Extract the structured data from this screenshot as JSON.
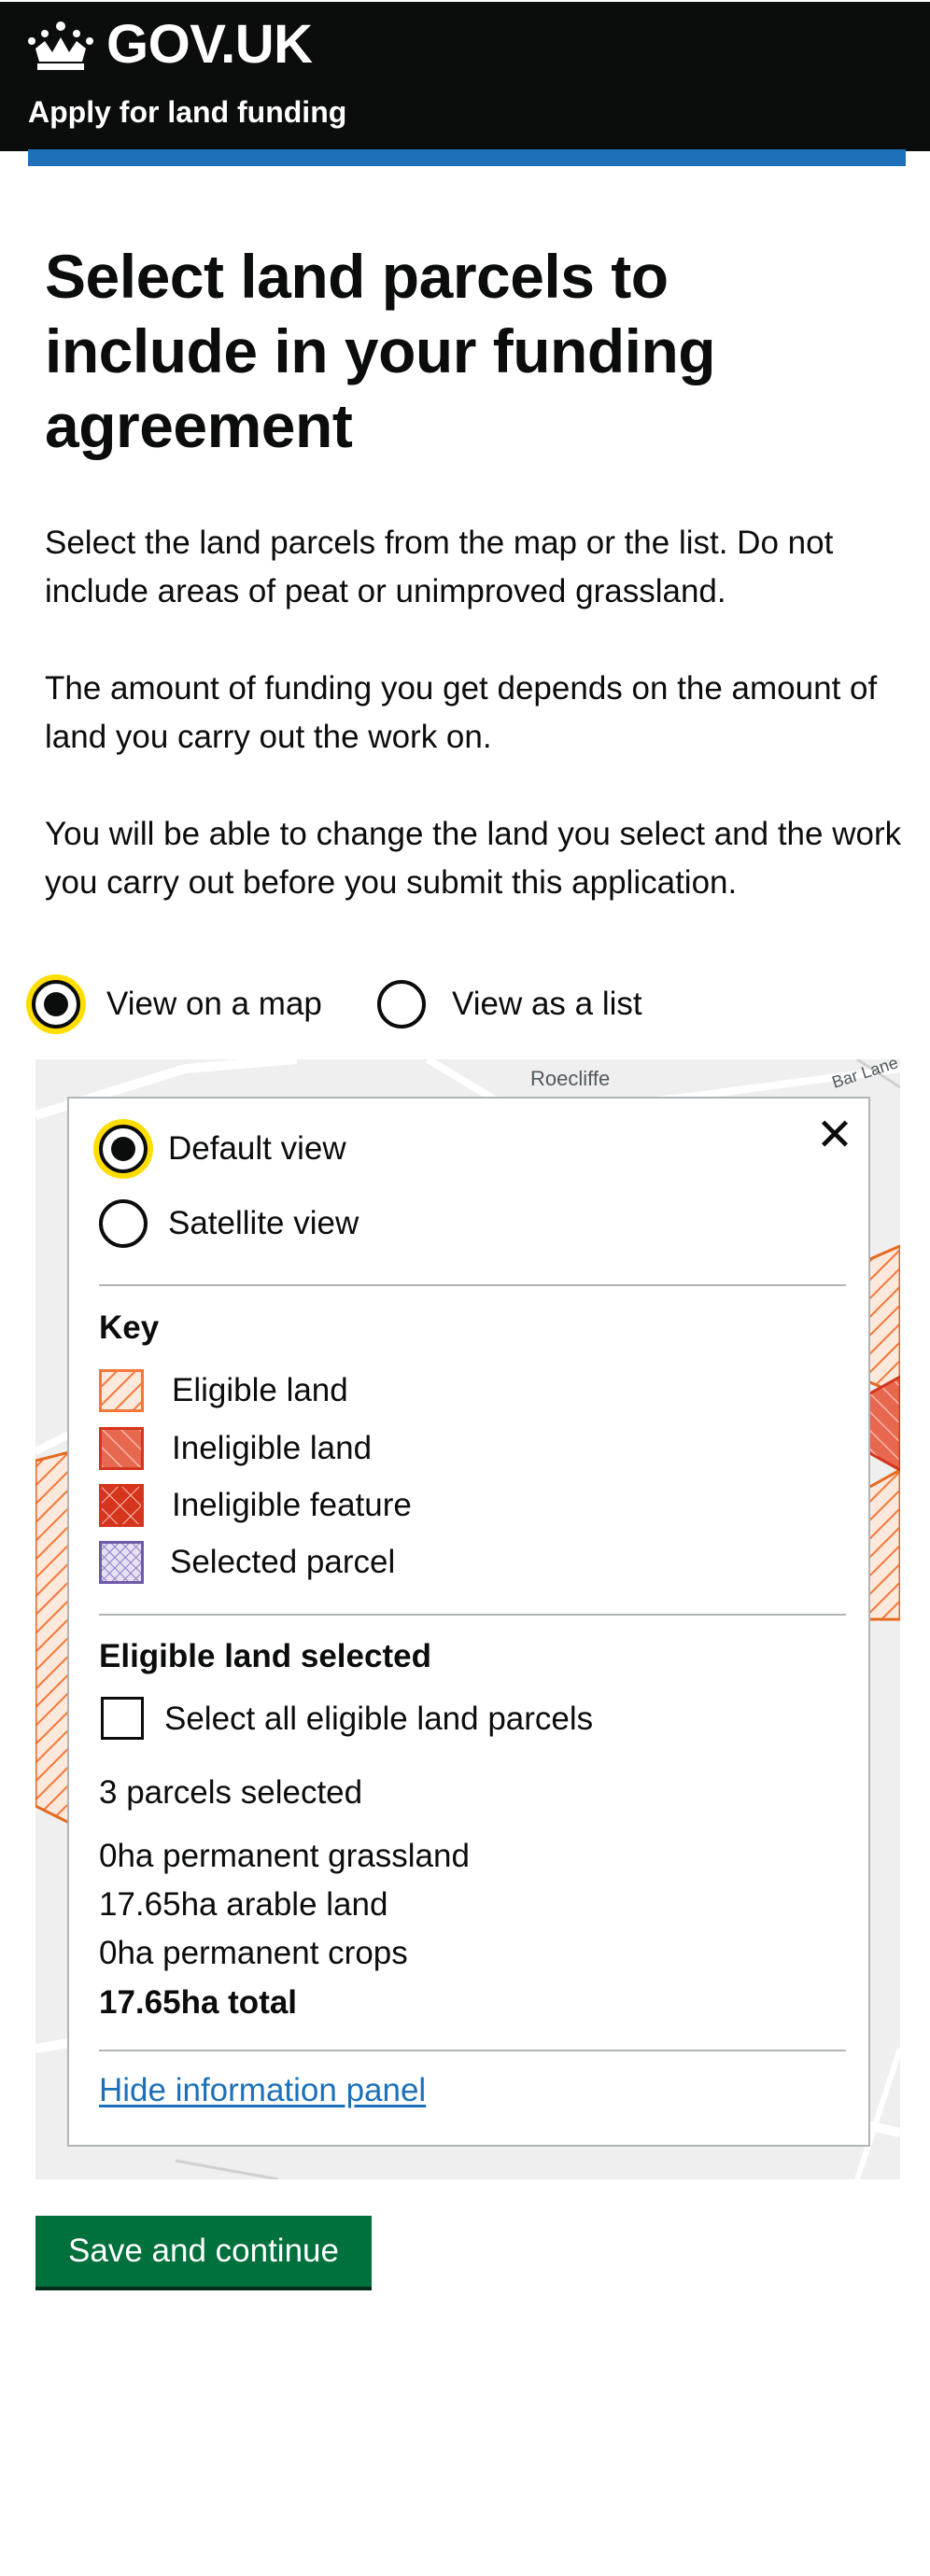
{
  "header": {
    "logo_text": "GOV.UK",
    "service_name": "Apply for land funding"
  },
  "page": {
    "title": "Select land parcels to include in your funding agreement",
    "paragraphs": [
      "Select the land parcels from the map or the list. Do not include areas of peat or unimproved grassland.",
      "The amount of funding you get depends on the amount of land you carry out the work on.",
      "You will be able to change the land you select and the work you carry out before you submit this application."
    ]
  },
  "view_options": [
    {
      "label": "View on a map",
      "checked": true
    },
    {
      "label": "View as a list",
      "checked": false
    }
  ],
  "map": {
    "place_labels": [
      "Roecliffe",
      "Bar Lane"
    ]
  },
  "panel": {
    "close_symbol": "✕",
    "basemap_options": [
      {
        "label": "Default view",
        "checked": true
      },
      {
        "label": "Satellite view",
        "checked": false
      }
    ],
    "key_heading": "Key",
    "key_items": [
      {
        "label": "Eligible land",
        "icon": "eligible-land-swatch",
        "color": "#f47738"
      },
      {
        "label": "Ineligible land",
        "icon": "ineligible-land-swatch",
        "color": "#d4351c"
      },
      {
        "label": "Ineligible feature",
        "icon": "ineligible-feature-swatch",
        "color": "#d4351c"
      },
      {
        "label": "Selected parcel",
        "icon": "selected-parcel-swatch",
        "color": "#4c2c92"
      }
    ],
    "eligible_heading": "Eligible land selected",
    "select_all_label": "Select all eligible land parcels",
    "select_all_checked": false,
    "parcels_selected": "3 parcels selected",
    "totals": [
      "0ha permanent grassland",
      "17.65ha arable land",
      "0ha permanent crops"
    ],
    "total_label": "17.65ha total",
    "hide_link": "Hide information panel"
  },
  "actions": {
    "save_label": "Save and continue"
  },
  "colors": {
    "header_bg": "#0b0c0c",
    "brand_blue": "#1d70b8",
    "button_green": "#00703c",
    "focus_yellow": "#ffdd00",
    "link_blue": "#1d70b8"
  }
}
